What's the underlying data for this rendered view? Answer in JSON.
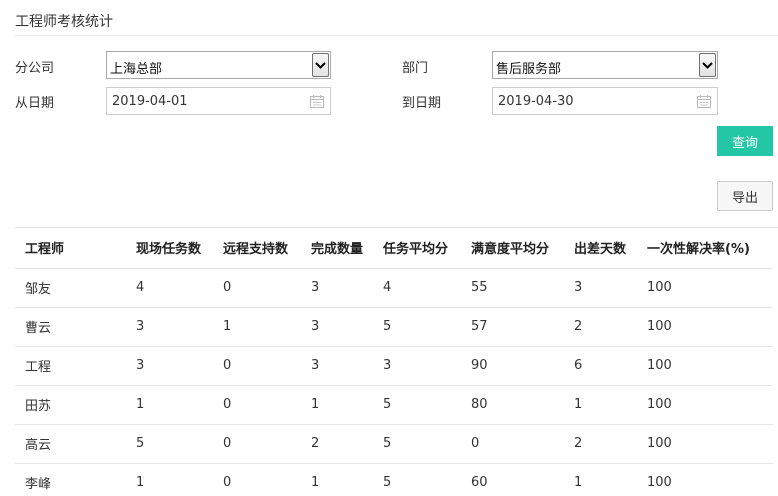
{
  "page": {
    "title": "工程师考核统计"
  },
  "filters": {
    "company_label": "分公司",
    "company_value": "上海总部",
    "department_label": "部门",
    "department_value": "售后服务部",
    "from_label": "从日期",
    "from_value": "2019-04-01",
    "to_label": "到日期",
    "to_value": "2019-04-30"
  },
  "buttons": {
    "query": "查询",
    "export": "导出"
  },
  "table": {
    "headers": [
      "工程师",
      "现场任务数",
      "远程支持数",
      "完成数量",
      "任务平均分",
      "满意度平均分",
      "出差天数",
      "一次性解决率(%)"
    ],
    "rows": [
      [
        "邹友",
        "4",
        "0",
        "3",
        "4",
        "55",
        "3",
        "100"
      ],
      [
        "曹云",
        "3",
        "1",
        "3",
        "5",
        "57",
        "2",
        "100"
      ],
      [
        "工程",
        "3",
        "0",
        "3",
        "3",
        "90",
        "6",
        "100"
      ],
      [
        "田苏",
        "1",
        "0",
        "1",
        "5",
        "80",
        "1",
        "100"
      ],
      [
        "高云",
        "5",
        "0",
        "2",
        "5",
        "0",
        "2",
        "100"
      ],
      [
        "李峰",
        "1",
        "0",
        "1",
        "5",
        "60",
        "1",
        "100"
      ]
    ]
  },
  "icons": {
    "dropdown": "chevron-down-icon",
    "calendar": "calendar-icon"
  }
}
